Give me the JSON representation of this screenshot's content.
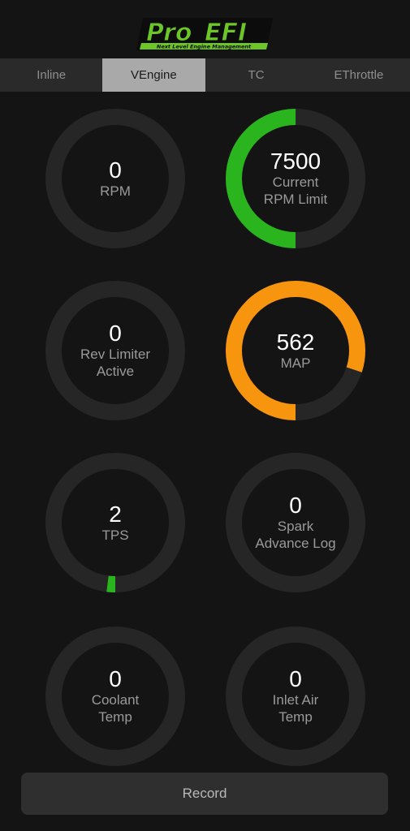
{
  "header": {
    "logo_pro": "Pro",
    "logo_efi": "EFI",
    "logo_tagline": "Next Level Engine Management"
  },
  "tabs": [
    {
      "label": "Inline",
      "active": false
    },
    {
      "label": "VEngine",
      "active": true
    },
    {
      "label": "TC",
      "active": false
    },
    {
      "label": "EThrottle",
      "active": false
    }
  ],
  "gauges": [
    {
      "value": "0",
      "label": "RPM",
      "fill": 0,
      "color": "#2ab51f"
    },
    {
      "value": "7500",
      "label": "Current\nRPM Limit",
      "fill": 0.5,
      "color": "#2ab51f"
    },
    {
      "value": "0",
      "label": "Rev Limiter\nActive",
      "fill": 0,
      "color": "#2ab51f"
    },
    {
      "value": "562",
      "label": "MAP",
      "fill": 0.8,
      "color": "#f7950f"
    },
    {
      "value": "2",
      "label": "TPS",
      "fill": 0.02,
      "color": "#2ab51f"
    },
    {
      "value": "0",
      "label": "Spark\nAdvance Log",
      "fill": 0,
      "color": "#2ab51f"
    },
    {
      "value": "0",
      "label": "Coolant\nTemp",
      "fill": 0,
      "color": "#2ab51f"
    },
    {
      "value": "0",
      "label": "Inlet Air\nTemp",
      "fill": 0,
      "color": "#2ab51f"
    }
  ],
  "record": {
    "label": "Record"
  },
  "colors": {
    "background": "#141414",
    "track": "#262626",
    "brand_green": "#6cc627",
    "tab_bar": "#2a2a2a",
    "tab_active": "#a9a9a9"
  }
}
